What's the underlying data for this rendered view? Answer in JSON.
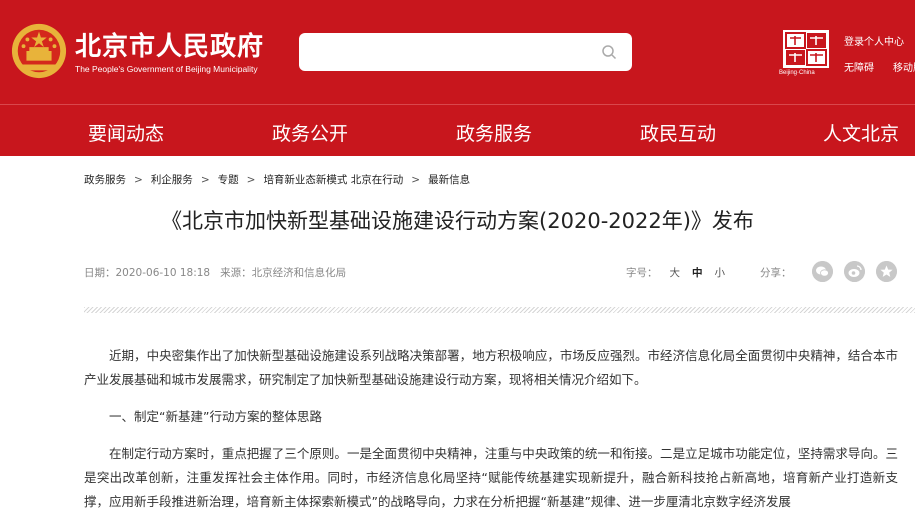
{
  "header": {
    "site_title": "北京市人民政府",
    "site_subtitle": "The People's Government of Beijing Municipality",
    "search_placeholder": "",
    "capital_caption": "Beijing·China",
    "login_label": "登录个人中心",
    "barrier_free_label": "无障碍",
    "mobile_label": "移动版"
  },
  "nav": {
    "items": [
      "要闻动态",
      "政务公开",
      "政务服务",
      "政民互动",
      "人文北京"
    ]
  },
  "breadcrumb": {
    "items": [
      "政务服务",
      "利企服务",
      "专题",
      "培育新业态新模式 北京在行动",
      "最新信息"
    ],
    "separator": ">"
  },
  "article": {
    "title": "《北京市加快新型基础设施建设行动方案(2020-2022年)》发布",
    "date": "日期：2020-06-10 18:18",
    "source": "来源：北京经济和信息化局",
    "font_size_label": "字号：",
    "font_sizes": [
      "大",
      "中",
      "小"
    ],
    "share_label": "分享：",
    "paragraphs": [
      "近期，中央密集作出了加快新型基础设施建设系列战略决策部署，地方积极响应，市场反应强烈。市经济信息化局全面贯彻中央精神，结合本市产业发展基础和城市发展需求，研究制定了加快新型基础设施建设行动方案，现将相关情况介绍如下。",
      "一、制定“新基建”行动方案的整体思路",
      "在制定行动方案时，重点把握了三个原则。一是全面贯彻中央精神，注重与中央政策的统一和衔接。二是立足城市功能定位，坚持需求导向。三是突出改革创新，注重发挥社会主体作用。同时，市经济信息化局坚持“赋能传统基建实现新提升，融合新科技抢占新高地，培育新产业打造新支撑，应用新手段推进新治理，培育新主体探索新模式”的战略导向，力求在分析把握“新基建”规律、进一步厘清北京数字经济发展"
    ]
  },
  "colors": {
    "brand_red": "#c8161d",
    "share_icon_gray": "#c8c8c8"
  },
  "icons": {
    "emblem": "national-emblem-icon",
    "search": "search-icon",
    "capital": "capital-logo-icon",
    "share": [
      "wechat-icon",
      "weibo-icon",
      "favorite-icon"
    ]
  }
}
